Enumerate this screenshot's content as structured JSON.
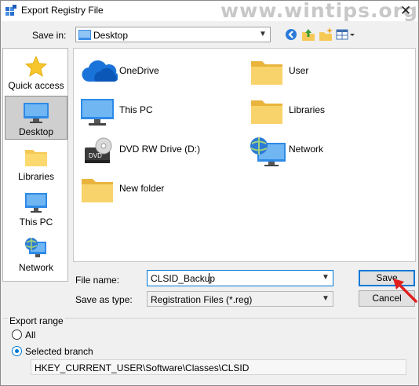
{
  "window": {
    "title": "Export Registry File",
    "watermark": "www.wintips.org",
    "close_symbol": "✕"
  },
  "savein": {
    "label": "Save in:",
    "value": "Desktop"
  },
  "places": [
    {
      "label": "Quick access",
      "icon": "star-icon"
    },
    {
      "label": "Desktop",
      "icon": "desktop-icon",
      "selected": true
    },
    {
      "label": "Libraries",
      "icon": "libraries-folder-icon"
    },
    {
      "label": "This PC",
      "icon": "monitor-icon"
    },
    {
      "label": "Network",
      "icon": "network-icon"
    }
  ],
  "files": [
    {
      "label": "OneDrive",
      "icon": "cloud-icon"
    },
    {
      "label": "User",
      "icon": "folder-icon"
    },
    {
      "label": "This PC",
      "icon": "monitor-icon"
    },
    {
      "label": "Libraries",
      "icon": "folder-icon"
    },
    {
      "label": "DVD RW Drive (D:)",
      "icon": "dvd-drive-icon",
      "badge": "DVD"
    },
    {
      "label": "Network",
      "icon": "network-icon"
    },
    {
      "label": "New folder",
      "icon": "folder-icon"
    }
  ],
  "form": {
    "filename_label": "File name:",
    "filename_value": "CLSID_Backup",
    "type_label": "Save as type:",
    "type_value": "Registration Files (*.reg)",
    "save_label": "Save",
    "cancel_label": "Cancel"
  },
  "export_range": {
    "label": "Export range",
    "all_label": "All",
    "selected_label": "Selected branch",
    "selected": "selected",
    "branch_value": "HKEY_CURRENT_USER\\Software\\Classes\\CLSID"
  },
  "colors": {
    "accent": "#0078d7",
    "folder": "#f6c956",
    "arrow": "#e02020"
  }
}
